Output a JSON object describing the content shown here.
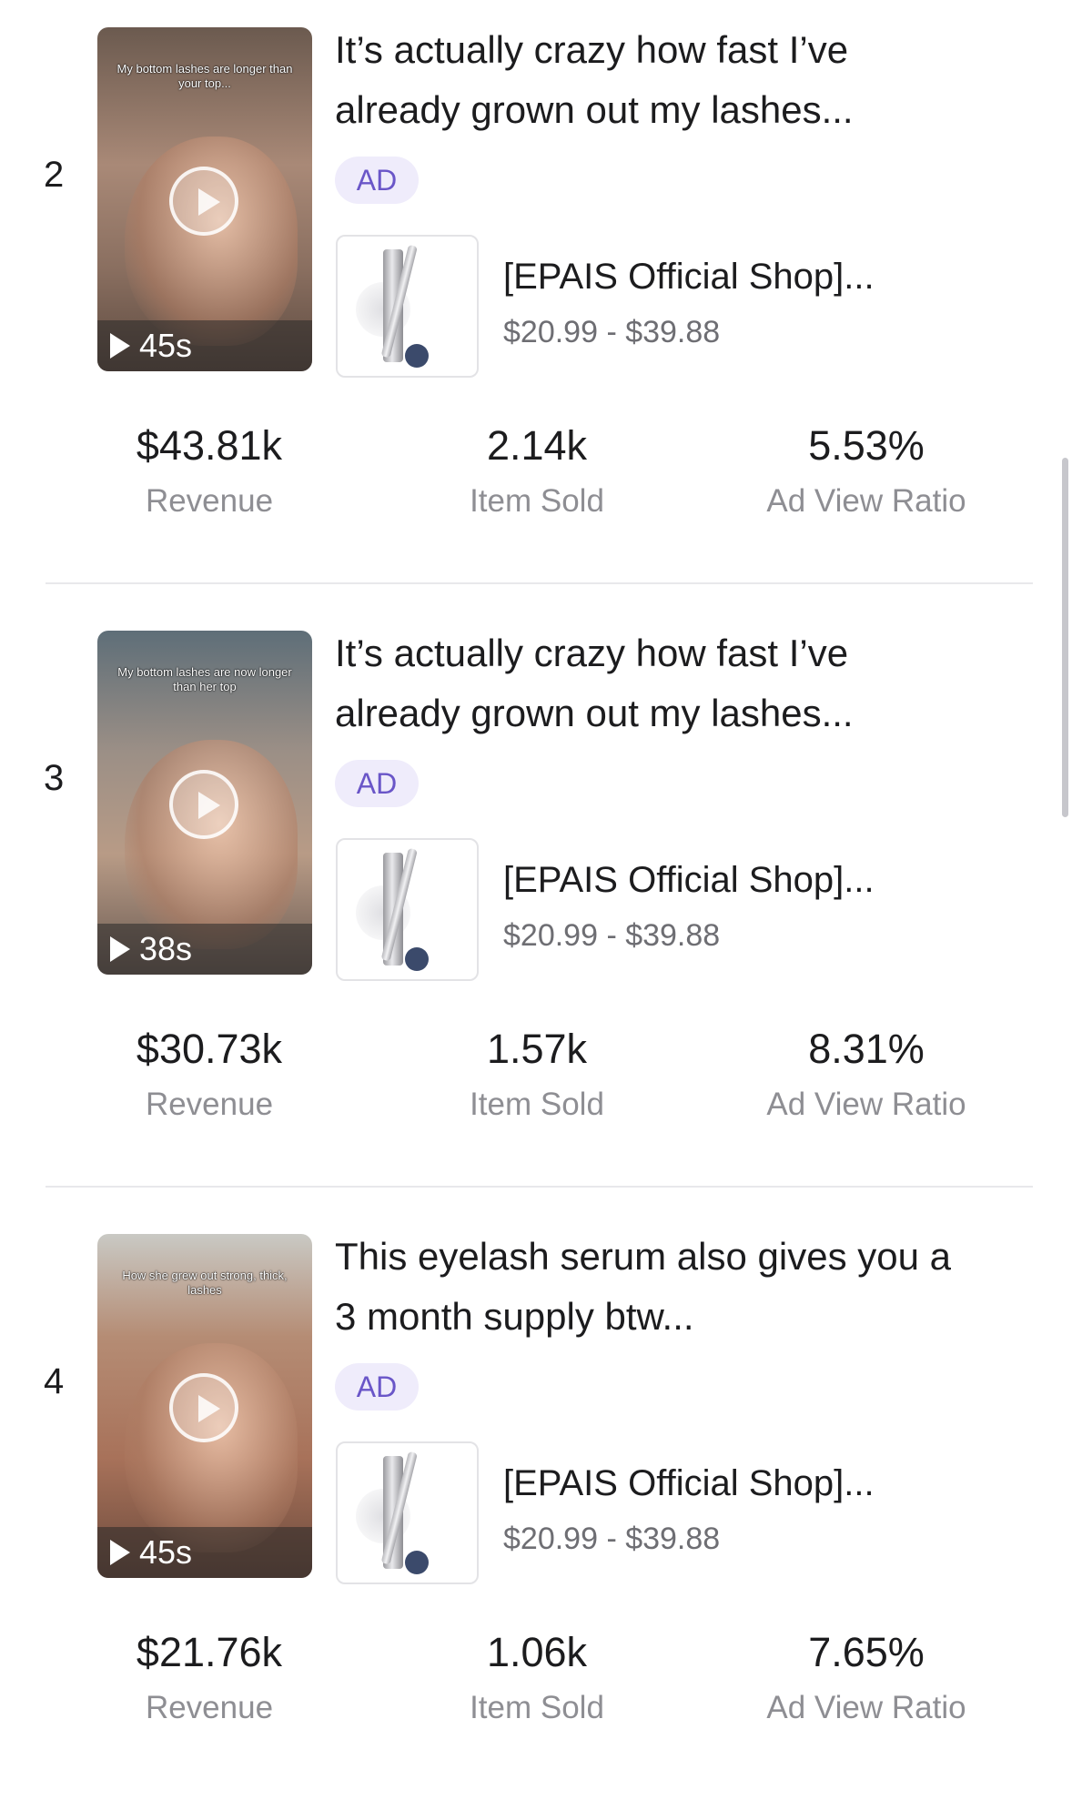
{
  "items": [
    {
      "rank": "2",
      "video_caption": "My bottom lashes are longer than your top...",
      "duration": "45s",
      "title_line1": "It’s actually crazy how fast I’ve",
      "title_line2": "already grown out my lashes...",
      "ad_label": "AD",
      "shop": "[EPAIS Official Shop]...",
      "price": "$20.99 - $39.88",
      "revenue": "$43.81k",
      "revenue_label": "Revenue",
      "items_sold": "2.14k",
      "items_sold_label": "Item Sold",
      "ad_view_ratio": "5.53%",
      "ad_view_ratio_label": "Ad View Ratio"
    },
    {
      "rank": "3",
      "video_caption": "My bottom lashes are now longer than her top",
      "duration": "38s",
      "title_line1": "It’s actually crazy how fast I’ve",
      "title_line2": "already grown out my lashes...",
      "ad_label": "AD",
      "shop": "[EPAIS Official Shop]...",
      "price": "$20.99 - $39.88",
      "revenue": "$30.73k",
      "revenue_label": "Revenue",
      "items_sold": "1.57k",
      "items_sold_label": "Item Sold",
      "ad_view_ratio": "8.31%",
      "ad_view_ratio_label": "Ad View Ratio"
    },
    {
      "rank": "4",
      "video_caption": "How she grew out strong, thick, lashes",
      "duration": "45s",
      "title_line1": "This eyelash serum also gives you a",
      "title_line2": "3 month supply btw...",
      "ad_label": "AD",
      "shop": "[EPAIS Official Shop]...",
      "price": "$20.99 - $39.88",
      "revenue": "$21.76k",
      "revenue_label": "Revenue",
      "items_sold": "1.06k",
      "items_sold_label": "Item Sold",
      "ad_view_ratio": "7.65%",
      "ad_view_ratio_label": "Ad View Ratio"
    }
  ],
  "colors": {
    "ad_badge_bg": "#efecfb",
    "ad_badge_text": "#6a56c8",
    "label_gray": "#8e8e93"
  },
  "icons": {
    "video_play": "play-circle-icon",
    "duration_play": "play-triangle-icon"
  }
}
